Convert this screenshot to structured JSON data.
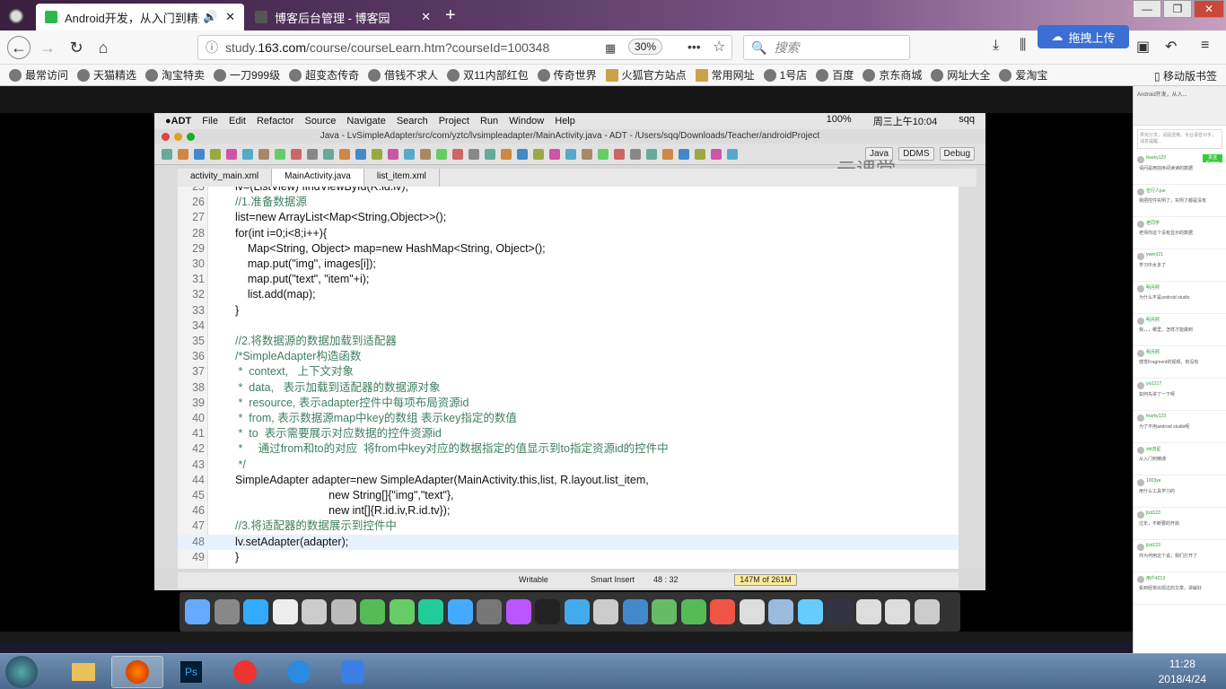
{
  "browser": {
    "tabs": [
      {
        "title": "Android开发，从入门到精通",
        "active": true
      },
      {
        "title": "博客后台管理 - 博客园",
        "active": false
      }
    ],
    "url_prefix": "study.",
    "url_domain": "163.com",
    "url_path": "/course/courseLearn.htm?courseId=100348",
    "zoom": "30%",
    "search_placeholder": "搜索",
    "upload_label": "拖拽上传",
    "bookmarks": [
      "最常访问",
      "天猫精选",
      "淘宝特卖",
      "一刀999级",
      "超变态传奇",
      "借钱不求人",
      "双11内部红包",
      "传奇世界",
      "火狐官方站点",
      "常用网址",
      "1号店",
      "百度",
      "京东商城",
      "网址大全",
      "爱淘宝"
    ],
    "mobile_bookmarks": "移动版书签"
  },
  "mac": {
    "menu": [
      "ADT",
      "File",
      "Edit",
      "Refactor",
      "Source",
      "Navigate",
      "Search",
      "Project",
      "Run",
      "Window",
      "Help"
    ],
    "battery": "100%",
    "clock": "周三上午10:04",
    "user": "sqq",
    "window_title": "Java - LvSimpleAdapter/src/com/yztc/lvsimpleadapter/MainActivity.java - ADT - /Users/sqq/Downloads/Teacher/androidProject",
    "perspectives": [
      "Java",
      "DDMS",
      "Debug"
    ],
    "watermark": "云课堂",
    "editor_tabs": [
      "activity_main.xml",
      "MainActivity.java",
      "list_item.xml"
    ],
    "code": [
      {
        "n": "25",
        "t": "lv=(ListView) findViewById(R.id.lv);",
        "c": "plain"
      },
      {
        "n": "26",
        "t": "//1.准备数据源",
        "c": "cm"
      },
      {
        "n": "27",
        "t": "list=new ArrayList<Map<String,Object>>();",
        "c": "plain"
      },
      {
        "n": "28",
        "t": "for(int i=0;i<8;i++){",
        "c": "plain"
      },
      {
        "n": "29",
        "t": "    Map<String, Object> map=new HashMap<String, Object>();",
        "c": "plain"
      },
      {
        "n": "30",
        "t": "    map.put(\"img\", images[i]);",
        "c": "plain"
      },
      {
        "n": "31",
        "t": "    map.put(\"text\", \"item\"+i);",
        "c": "plain"
      },
      {
        "n": "32",
        "t": "    list.add(map);",
        "c": "plain"
      },
      {
        "n": "33",
        "t": "}",
        "c": "plain"
      },
      {
        "n": "34",
        "t": "",
        "c": "plain"
      },
      {
        "n": "35",
        "t": "//2.将数据源的数据加载到适配器",
        "c": "cm"
      },
      {
        "n": "36",
        "t": "/*SimpleAdapter构造函数",
        "c": "cm"
      },
      {
        "n": "37",
        "t": " *  context,   上下文对象",
        "c": "cm"
      },
      {
        "n": "38",
        "t": " *  data,   表示加载到适配器的数据源对象",
        "c": "cm"
      },
      {
        "n": "39",
        "t": " *  resource, 表示adapter控件中每项布局资源id",
        "c": "cm"
      },
      {
        "n": "40",
        "t": " *  from, 表示数据源map中key的数组 表示key指定的数值",
        "c": "cm"
      },
      {
        "n": "41",
        "t": " *  to  表示需要展示对应数据的控件资源id",
        "c": "cm"
      },
      {
        "n": "42",
        "t": " *     通过from和to的对应  将from中key对应的数据指定的值显示到to指定资源id的控件中",
        "c": "cm"
      },
      {
        "n": "43",
        "t": " */",
        "c": "cm"
      },
      {
        "n": "44",
        "t": "SimpleAdapter adapter=new SimpleAdapter(MainActivity.this,list, R.layout.list_item,",
        "c": "plain"
      },
      {
        "n": "45",
        "t": "                              new String[]{\"img\",\"text\"},",
        "c": "plain"
      },
      {
        "n": "46",
        "t": "                              new int[]{R.id.iv,R.id.tv});",
        "c": "plain"
      },
      {
        "n": "47",
        "t": "//3.将适配器的数据展示到控件中",
        "c": "cm"
      },
      {
        "n": "48",
        "t": "lv.setAdapter(adapter);",
        "c": "plain"
      },
      {
        "n": "49",
        "t": "}",
        "c": "plain"
      }
    ],
    "status": {
      "writable": "Writable",
      "insert": "Smart Insert",
      "pos": "48 : 32",
      "mem": "147M of 261M"
    }
  },
  "chat": {
    "header_line1": "Android开发，从入...",
    "input_placeholder": "弄完分享，请提送哦，专业语音对手，消息提醒...",
    "send_label": "发送(Enter)",
    "messages": [
      {
        "name": "fearky123",
        "text": "请问是用前序阅读读的数据"
      },
      {
        "name": "伍行人jue",
        "text": "我把控件实例了，实例了都是没有"
      },
      {
        "name": "老同学",
        "text": "老师你这个没有显示的数据"
      },
      {
        "name": "ywer321",
        "text": "学习中太多了"
      },
      {
        "name": "明月照",
        "text": "为什么不是android studio"
      },
      {
        "name": "明月照",
        "text": "我，，，哪里，怎样才能做到"
      },
      {
        "name": "明月照",
        "text": "感觉Fragment的视频，有没有"
      },
      {
        "name": "yis1217",
        "text": "如何先讲了一下呀"
      },
      {
        "name": "fearky123",
        "text": "为了不用android studio呢"
      },
      {
        "name": "skt流星",
        "text": "从入门到精通"
      },
      {
        "name": "1003ye",
        "text": "用什么工具学习的"
      },
      {
        "name": "jlzd123",
        "text": "过年，不断要的开启"
      },
      {
        "name": "jlzd123",
        "text": "你为何用这个说，我们打开了"
      },
      {
        "name": "用户4213",
        "text": "看到经常出现过的文章，讲解好"
      }
    ]
  },
  "taskbar": {
    "time": "11:28",
    "date": "2018/4/24"
  }
}
